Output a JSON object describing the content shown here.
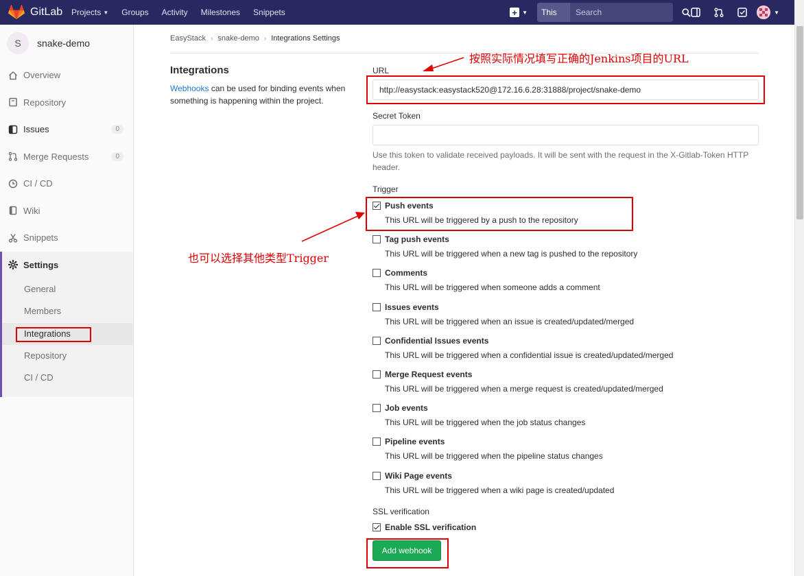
{
  "navbar": {
    "brand": "GitLab",
    "links": [
      {
        "label": "Projects",
        "dropdown": true
      },
      {
        "label": "Groups",
        "dropdown": false
      },
      {
        "label": "Activity",
        "dropdown": false
      },
      {
        "label": "Milestones",
        "dropdown": false
      },
      {
        "label": "Snippets",
        "dropdown": false
      }
    ],
    "search_scope": "This project",
    "search_placeholder": "Search",
    "bg_color": "#292961"
  },
  "sidebar": {
    "project_initial": "S",
    "project_name": "snake-demo",
    "items": [
      {
        "label": "Overview",
        "icon": "home-icon"
      },
      {
        "label": "Repository",
        "icon": "book-icon"
      },
      {
        "label": "Issues",
        "icon": "issues-icon",
        "badge": "0"
      },
      {
        "label": "Merge Requests",
        "icon": "merge-request-icon",
        "badge": "0"
      },
      {
        "label": "CI / CD",
        "icon": "rocket-icon"
      },
      {
        "label": "Wiki",
        "icon": "book-icon"
      },
      {
        "label": "Snippets",
        "icon": "scissors-icon"
      }
    ],
    "settings": {
      "label": "Settings",
      "sub_items": [
        "General",
        "Members",
        "Integrations",
        "Repository",
        "CI / CD"
      ],
      "active": "Integrations"
    }
  },
  "breadcrumb": [
    "EasyStack",
    "snake-demo",
    "Integrations Settings"
  ],
  "intro": {
    "title": "Integrations",
    "link_text": "Webhooks",
    "text": " can be used for binding events when something is happening within the project."
  },
  "form": {
    "url_label": "URL",
    "url_value": "http://easystack:easystack520@172.16.6.28:31888/project/snake-demo",
    "token_label": "Secret Token",
    "token_value": "",
    "token_hint": "Use this token to validate received payloads. It will be sent with the request in the X-Gitlab-Token HTTP header.",
    "trigger_label": "Trigger",
    "triggers": [
      {
        "name": "Push events",
        "desc": "This URL will be triggered by a push to the repository",
        "checked": true
      },
      {
        "name": "Tag push events",
        "desc": "This URL will be triggered when a new tag is pushed to the repository",
        "checked": false
      },
      {
        "name": "Comments",
        "desc": "This URL will be triggered when someone adds a comment",
        "checked": false
      },
      {
        "name": "Issues events",
        "desc": "This URL will be triggered when an issue is created/updated/merged",
        "checked": false
      },
      {
        "name": "Confidential Issues events",
        "desc": "This URL will be triggered when a confidential issue is created/updated/merged",
        "checked": false
      },
      {
        "name": "Merge Request events",
        "desc": "This URL will be triggered when a merge request is created/updated/merged",
        "checked": false
      },
      {
        "name": "Job events",
        "desc": "This URL will be triggered when the job status changes",
        "checked": false
      },
      {
        "name": "Pipeline events",
        "desc": "This URL will be triggered when the pipeline status changes",
        "checked": false
      },
      {
        "name": "Wiki Page events",
        "desc": "This URL will be triggered when a wiki page is created/updated",
        "checked": false
      }
    ],
    "ssl_label": "SSL verification",
    "ssl_option": "Enable SSL verification",
    "ssl_checked": true,
    "submit_label": "Add webhook",
    "submit_color": "#1aaa55"
  },
  "annotations": {
    "url_note": "按照实际情况填写正确的Jenkins项目的URL",
    "trigger_note": "也可以选择其他类型Trigger",
    "color": "#e00000"
  }
}
